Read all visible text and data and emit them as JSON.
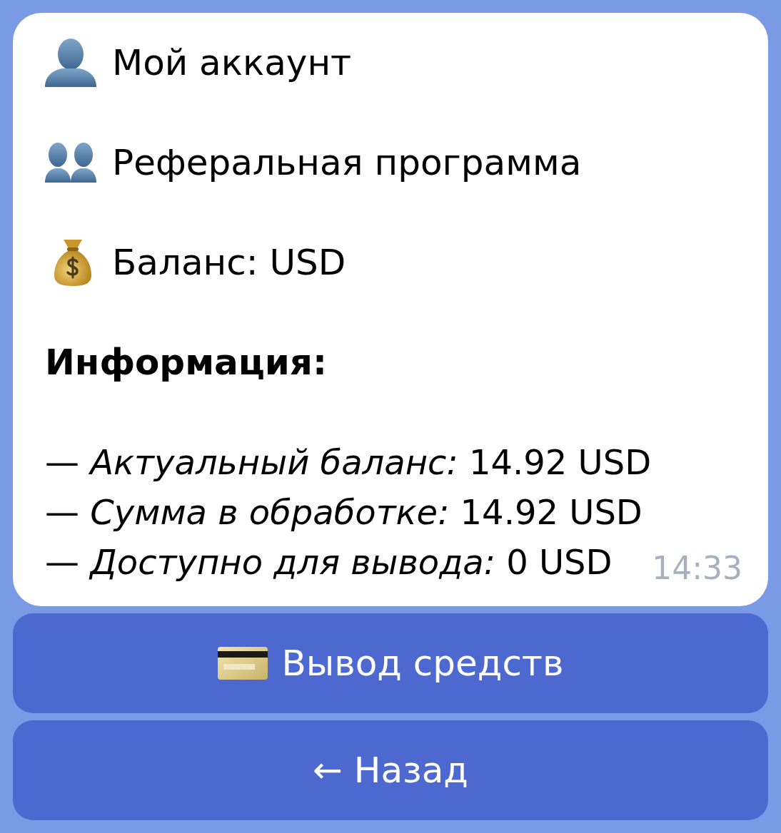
{
  "message": {
    "account": {
      "label": "Мой аккаунт"
    },
    "referral": {
      "label": "Реферальная программа"
    },
    "balance": {
      "label": "Баланс: USD"
    },
    "info": {
      "heading": "Информация:",
      "items": [
        "— *Актуальный баланс:* 14.92 USD",
        "— *Сумма в обработке:* 14.92 USD",
        "— *Доступно для вывода:* 0 USD"
      ]
    },
    "time": "14:33"
  },
  "buttons": [
    {
      "kind": "withdraw",
      "label": "Вывод средств"
    },
    {
      "kind": "back",
      "label": "← Назад"
    }
  ]
}
